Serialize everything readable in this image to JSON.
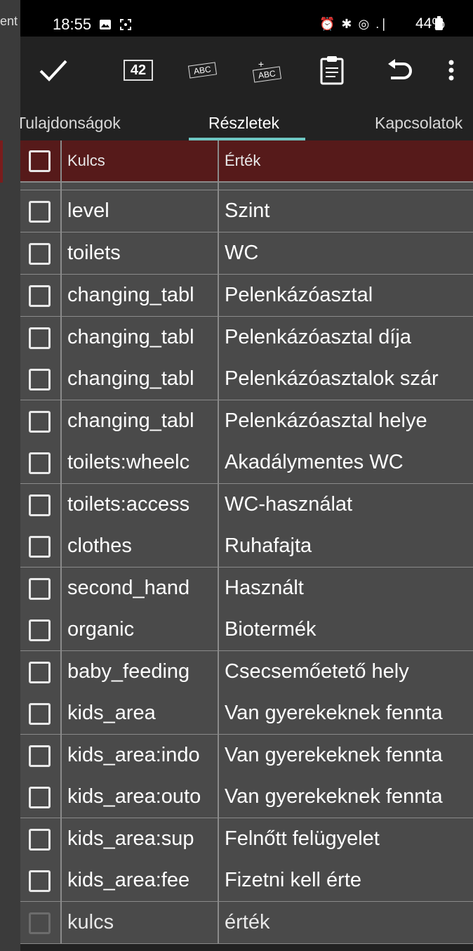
{
  "left_fragment": "ent",
  "status_bar": {
    "time": "18:55",
    "system_icons": "⏰ ✱ ◎ .∣",
    "battery": "44%"
  },
  "toolbar": {
    "number_button": "42",
    "abc_button": "ABC",
    "add_abc_button": "ABC",
    "add_plus": "+"
  },
  "tabs": [
    {
      "label": "Tulajdonságok",
      "active": false
    },
    {
      "label": "Részletek",
      "active": true
    },
    {
      "label": "Kapcsolatok",
      "active": false
    }
  ],
  "table": {
    "header": {
      "key": "Kulcs",
      "value": "Érték"
    },
    "rows": [
      {
        "key": "level",
        "value": "Szint"
      },
      {
        "key": "toilets",
        "value": "WC"
      },
      {
        "key": "changing_tabl",
        "value": "Pelenkázóasztal"
      },
      {
        "key": "changing_tabl",
        "value": "Pelenkázóasztal díja"
      },
      {
        "key": "changing_tabl",
        "value": "Pelenkázóasztalok szár"
      },
      {
        "key": "changing_tabl",
        "value": "Pelenkázóasztal helye"
      },
      {
        "key": "toilets:wheelc",
        "value": "Akadálymentes WC"
      },
      {
        "key": "toilets:access",
        "value": "WC-használat"
      },
      {
        "key": "clothes",
        "value": "Ruhafajta"
      },
      {
        "key": "second_hand",
        "value": "Használt"
      },
      {
        "key": "organic",
        "value": "Biotermék"
      },
      {
        "key": "baby_feeding",
        "value": "Csecsemőetető hely"
      },
      {
        "key": "kids_area",
        "value": "Van gyerekeknek fennta"
      },
      {
        "key": "kids_area:indo",
        "value": "Van gyerekeknek fennta"
      },
      {
        "key": "kids_area:outo",
        "value": "Van gyerekeknek fennta"
      },
      {
        "key": "kids_area:sup",
        "value": "Felnőtt felügyelet"
      },
      {
        "key": "kids_area:fee",
        "value": "Fizetni kell érte"
      }
    ],
    "new_row": {
      "key": "kulcs",
      "value": "érték"
    }
  },
  "colors": {
    "header_bg": "#561a1a",
    "tab_indicator": "#6ec6c2",
    "toolbar_bg": "#222222",
    "table_bg": "#4a4a4a"
  }
}
